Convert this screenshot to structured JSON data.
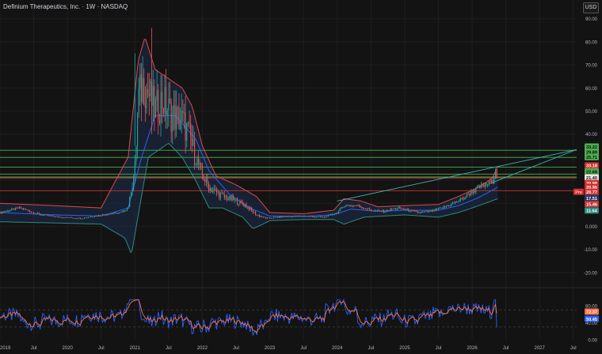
{
  "header": {
    "title": "Definium Therapeutics, Inc. · 1W · NASDAQ",
    "currency": "USD"
  },
  "colors": {
    "background": "#131313",
    "grid": "#1e1e1e",
    "up_candle": "#26a69a",
    "down_candle": "#ef5350",
    "bb_upper": "#e04848",
    "bb_lower": "#2a8c80",
    "bb_basis": "#2962ff",
    "bb_fill": "#1b2e4d",
    "h_green": "#4caf50",
    "h_red": "#d32f2f",
    "trendline": "#3fb8af",
    "rsi_blue": "#2962ff",
    "rsi_orange": "#ff7043"
  },
  "chart_data": [
    {
      "type": "candlestick",
      "title": "Definium Therapeutics, Inc. · 1W · NASDAQ",
      "ylim": [
        -29,
        94
      ],
      "y_ticks": [
        "90.00",
        "80.00",
        "70.00",
        "60.00",
        "50.00",
        "40.00",
        "30.00",
        "20.00",
        "10.00",
        "0.000",
        "-10.00",
        "-20.00"
      ],
      "x_ticks": [
        "2019",
        "Jul",
        "2020",
        "Jul",
        "2021",
        "Jul",
        "2022",
        "Jul",
        "2023",
        "Jul",
        "2024",
        "Jul",
        "2025",
        "Jul",
        "2026",
        "Jul",
        "2027",
        "Jul"
      ],
      "x_range_years": [
        2019.0,
        2027.55
      ],
      "price_path": [
        [
          2019.0,
          6
        ],
        [
          2019.3,
          8
        ],
        [
          2019.6,
          5
        ],
        [
          2019.9,
          4
        ],
        [
          2020.2,
          3.5
        ],
        [
          2020.5,
          5
        ],
        [
          2020.8,
          6
        ],
        [
          2020.9,
          8
        ],
        [
          2021.0,
          25
        ],
        [
          2021.05,
          55
        ],
        [
          2021.12,
          62
        ],
        [
          2021.2,
          58
        ],
        [
          2021.3,
          50
        ],
        [
          2021.4,
          55
        ],
        [
          2021.55,
          48
        ],
        [
          2021.7,
          46
        ],
        [
          2021.8,
          40
        ],
        [
          2021.9,
          30
        ],
        [
          2022.0,
          22
        ],
        [
          2022.1,
          17
        ],
        [
          2022.3,
          13
        ],
        [
          2022.5,
          11
        ],
        [
          2022.65,
          9
        ],
        [
          2022.8,
          5
        ],
        [
          2022.95,
          3.5
        ],
        [
          2023.2,
          4.2
        ],
        [
          2023.5,
          4.5
        ],
        [
          2023.8,
          4
        ],
        [
          2024.0,
          6
        ],
        [
          2024.1,
          9
        ],
        [
          2024.3,
          9
        ],
        [
          2024.5,
          7
        ],
        [
          2024.7,
          6.5
        ],
        [
          2024.9,
          8
        ],
        [
          2025.2,
          6
        ],
        [
          2025.4,
          6.5
        ],
        [
          2025.6,
          8.5
        ],
        [
          2025.8,
          11
        ],
        [
          2026.0,
          15
        ],
        [
          2026.15,
          17.5
        ],
        [
          2026.3,
          19
        ],
        [
          2026.35,
          25
        ],
        [
          2026.38,
          20.77
        ]
      ],
      "bollinger": {
        "upper": [
          [
            2019.0,
            10
          ],
          [
            2019.8,
            9
          ],
          [
            2020.5,
            8
          ],
          [
            2020.9,
            30
          ],
          [
            2021.05,
            72
          ],
          [
            2021.15,
            82
          ],
          [
            2021.3,
            68
          ],
          [
            2021.5,
            64
          ],
          [
            2021.7,
            60
          ],
          [
            2021.85,
            52
          ],
          [
            2022.0,
            35
          ],
          [
            2022.2,
            22
          ],
          [
            2022.5,
            18
          ],
          [
            2022.8,
            13
          ],
          [
            2023.0,
            6
          ],
          [
            2023.5,
            5.5
          ],
          [
            2023.95,
            7
          ],
          [
            2024.1,
            12
          ],
          [
            2024.35,
            11
          ],
          [
            2024.6,
            8.5
          ],
          [
            2025.0,
            9
          ],
          [
            2025.5,
            9.5
          ],
          [
            2025.8,
            13
          ],
          [
            2026.1,
            17
          ],
          [
            2026.3,
            21
          ],
          [
            2026.38,
            26
          ]
        ],
        "lower": [
          [
            2019.0,
            2
          ],
          [
            2019.8,
            1.5
          ],
          [
            2020.5,
            1
          ],
          [
            2020.85,
            -5
          ],
          [
            2020.95,
            -12
          ],
          [
            2021.05,
            5
          ],
          [
            2021.2,
            30
          ],
          [
            2021.5,
            36
          ],
          [
            2021.7,
            30
          ],
          [
            2021.9,
            20
          ],
          [
            2022.1,
            8
          ],
          [
            2022.3,
            8
          ],
          [
            2022.6,
            4
          ],
          [
            2022.75,
            -1
          ],
          [
            2022.9,
            1
          ],
          [
            2023.0,
            2.5
          ],
          [
            2023.5,
            3
          ],
          [
            2023.95,
            3
          ],
          [
            2024.1,
            1
          ],
          [
            2024.4,
            4
          ],
          [
            2024.7,
            4.5
          ],
          [
            2025.0,
            5
          ],
          [
            2025.5,
            4
          ],
          [
            2025.8,
            6
          ],
          [
            2026.1,
            9
          ],
          [
            2026.38,
            12
          ]
        ],
        "basis": [
          [
            2019.0,
            6
          ],
          [
            2019.8,
            5
          ],
          [
            2020.5,
            4.5
          ],
          [
            2020.9,
            8
          ],
          [
            2021.1,
            30
          ],
          [
            2021.3,
            48
          ],
          [
            2021.6,
            48
          ],
          [
            2021.9,
            38
          ],
          [
            2022.1,
            24
          ],
          [
            2022.4,
            14
          ],
          [
            2022.7,
            8
          ],
          [
            2023.0,
            4.5
          ],
          [
            2023.5,
            4.3
          ],
          [
            2023.95,
            5
          ],
          [
            2024.2,
            7.5
          ],
          [
            2024.6,
            6.5
          ],
          [
            2025.0,
            7
          ],
          [
            2025.5,
            7
          ],
          [
            2025.8,
            9
          ],
          [
            2026.1,
            12.5
          ],
          [
            2026.38,
            17
          ]
        ]
      },
      "horizontal_levels": [
        {
          "value": 33.0,
          "color": "green"
        },
        {
          "value": 29.89,
          "color": "green"
        },
        {
          "value": 25.71,
          "color": "green"
        },
        {
          "value": 22.68,
          "color": "green"
        },
        {
          "value": 21.4,
          "color": "green"
        },
        {
          "value": 20.98,
          "color": "red"
        },
        {
          "value": 15.46,
          "color": "red"
        }
      ],
      "trendlines": [
        {
          "x1": 2024.0,
          "y1": 11,
          "x2": 2027.55,
          "y2": 33.3
        },
        {
          "x1": 2026.3,
          "y1": 19,
          "x2": 2027.55,
          "y2": 33.3
        }
      ],
      "price_labels": [
        {
          "text": "33.22",
          "value": 34.6,
          "bg": "#4caf50",
          "fg": "#0b0b0b"
        },
        {
          "text": "29.89",
          "value": 32.3,
          "bg": "#4caf50",
          "fg": "#0b0b0b"
        },
        {
          "text": "25.71",
          "value": 30.0,
          "bg": "#4caf50",
          "fg": "#0b0b0b"
        },
        {
          "text": "33.18",
          "value": 26.4,
          "bg": "#d32f2f",
          "fg": "#ffffff"
        },
        {
          "text": "22.68",
          "value": 23.8,
          "bg": "#4caf50",
          "fg": "#0b0b0b"
        },
        {
          "text": "21.40",
          "value": 21.2,
          "bg": "#e8e8e8",
          "fg": "#111111"
        },
        {
          "text": "20.98",
          "value": 18.8,
          "bg": "#d32f2f",
          "fg": "#ffffff"
        },
        {
          "text": "20.95",
          "value": 17.1,
          "bg": "#d32f2f",
          "fg": "#ffffff"
        },
        {
          "text": "20.77",
          "value": 15.0,
          "bg": "#d32f2f",
          "fg": "#ffffff",
          "tag": "Pre"
        },
        {
          "text": "17.51",
          "value": 12.3,
          "bg": "#1e3a6e",
          "fg": "#ffffff"
        },
        {
          "text": "15.46",
          "value": 9.7,
          "bg": "#d32f2f",
          "fg": "#ffffff"
        },
        {
          "text": "11.64",
          "value": 6.9,
          "bg": "#2a8c80",
          "fg": "#ffffff"
        }
      ]
    },
    {
      "type": "line",
      "name": "RSI",
      "ylim": [
        0,
        100
      ],
      "y_ticks": [
        "80.00",
        "40.00",
        "0.00"
      ],
      "reference_levels": [
        70,
        30
      ],
      "labels": [
        {
          "text": "72.37",
          "value": 66,
          "bg": "#ff7043"
        },
        {
          "text": "50.45",
          "value": 49,
          "bg": "#2962ff"
        }
      ],
      "latest": 50.45
    }
  ]
}
